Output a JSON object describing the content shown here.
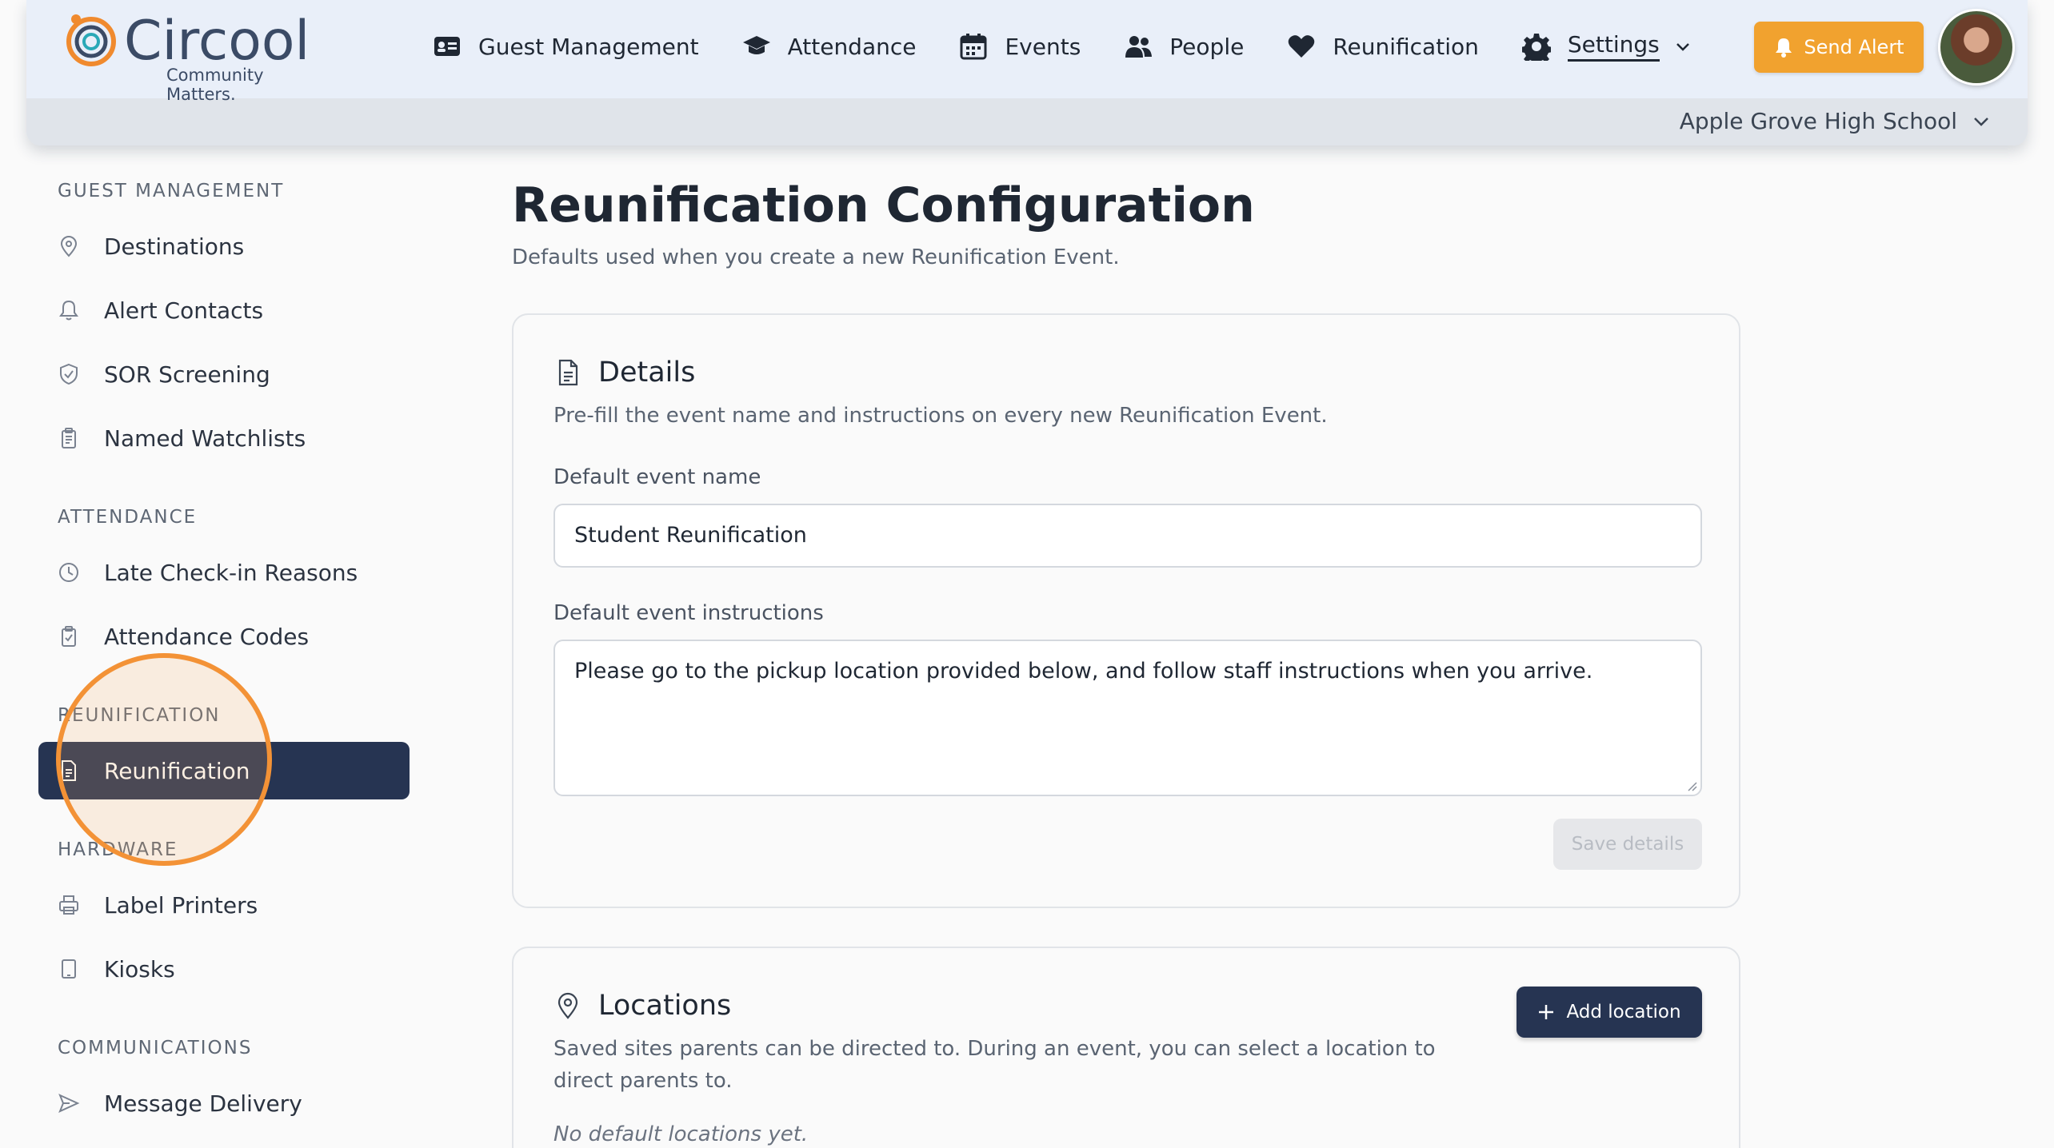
{
  "app": {
    "name": "Circool",
    "tagline": "Community Matters."
  },
  "nav": {
    "items": [
      {
        "label": "Guest Management",
        "icon": "id-card-icon"
      },
      {
        "label": "Attendance",
        "icon": "graduation-cap-icon"
      },
      {
        "label": "Events",
        "icon": "calendar-icon"
      },
      {
        "label": "People",
        "icon": "users-icon"
      },
      {
        "label": "Reunification",
        "icon": "heart-icon"
      },
      {
        "label": "Settings",
        "icon": "gear-icon",
        "active": true
      }
    ],
    "send_alert": "Send Alert",
    "school": "Apple Grove High School"
  },
  "sidebar": {
    "sections": [
      {
        "title": "GUEST MANAGEMENT",
        "items": [
          {
            "label": "Destinations",
            "icon": "map-pin-icon"
          },
          {
            "label": "Alert Contacts",
            "icon": "bell-icon"
          },
          {
            "label": "SOR Screening",
            "icon": "shield-icon"
          },
          {
            "label": "Named Watchlists",
            "icon": "clipboard-icon"
          }
        ]
      },
      {
        "title": "ATTENDANCE",
        "items": [
          {
            "label": "Late Check-in Reasons",
            "icon": "clock-icon"
          },
          {
            "label": "Attendance Codes",
            "icon": "clipboard-check-icon"
          }
        ]
      },
      {
        "title": "REUNIFICATION",
        "items": [
          {
            "label": "Reunification",
            "icon": "document-icon",
            "active": true
          }
        ]
      },
      {
        "title": "HARDWARE",
        "items": [
          {
            "label": "Label Printers",
            "icon": "printer-icon"
          },
          {
            "label": "Kiosks",
            "icon": "tablet-icon"
          }
        ]
      },
      {
        "title": "COMMUNICATIONS",
        "items": [
          {
            "label": "Message Delivery",
            "icon": "send-icon"
          }
        ]
      }
    ]
  },
  "page": {
    "title": "Reunification Configuration",
    "subtitle": "Defaults used when you create a new Reunification Event."
  },
  "details": {
    "title": "Details",
    "description": "Pre-fill the event name and instructions on every new Reunification Event.",
    "name_label": "Default event name",
    "name_value": "Student Reunification",
    "instructions_label": "Default event instructions",
    "instructions_value": "Please go to the pickup location provided below, and follow staff instructions when you arrive.",
    "save_label": "Save details"
  },
  "locations": {
    "title": "Locations",
    "description": "Saved sites parents can be directed to. During an event, you can select a location to direct parents to.",
    "add_label": "Add location",
    "empty": "No default locations yet."
  },
  "colors": {
    "accent": "#263452",
    "alert": "#f1a22f",
    "highlight": "#f39236"
  }
}
